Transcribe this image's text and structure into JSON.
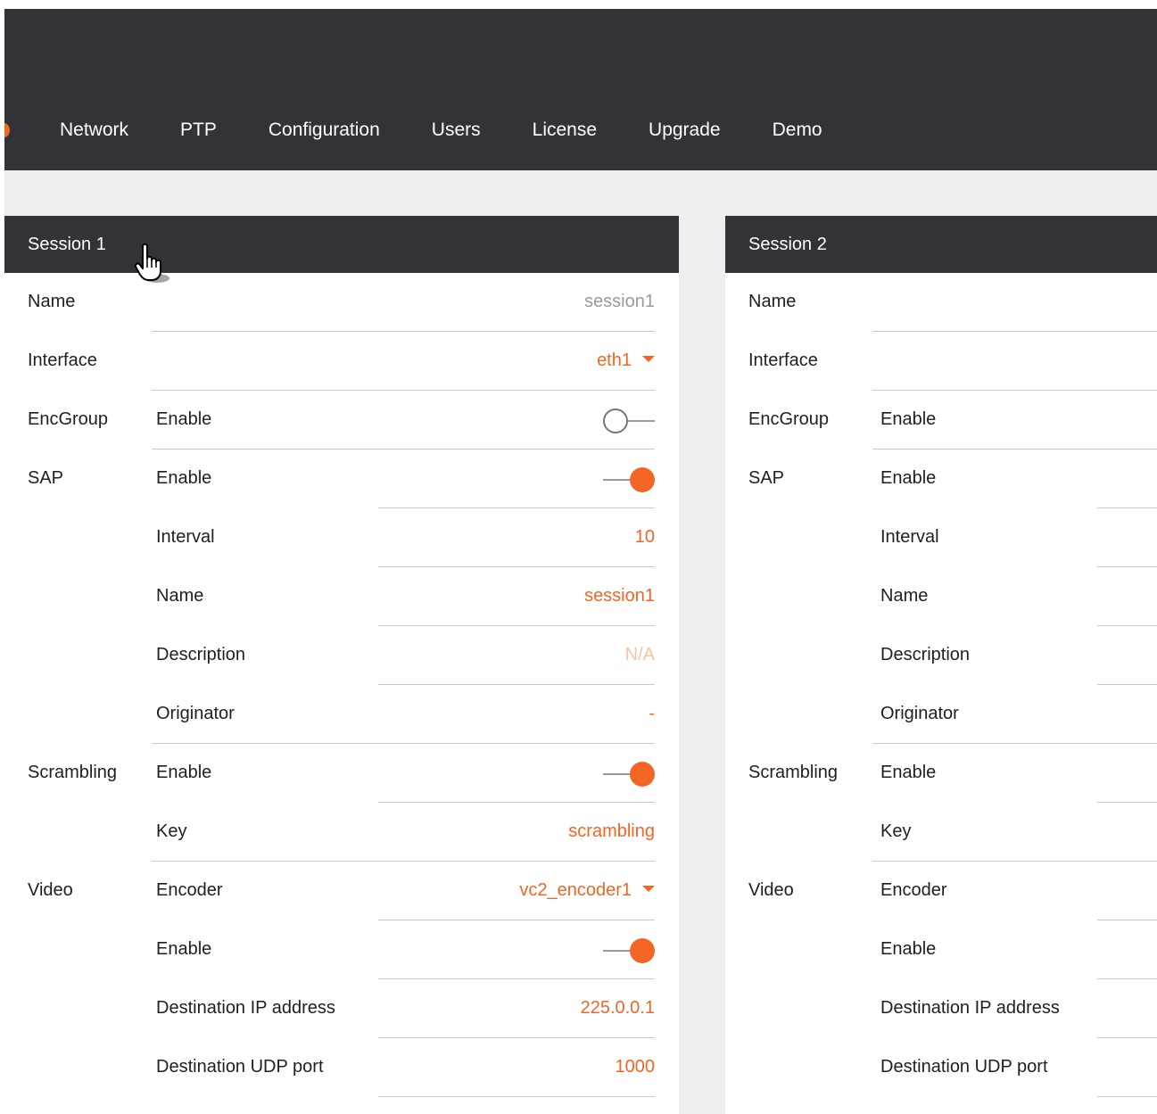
{
  "nav": {
    "items": [
      "Network",
      "PTP",
      "Configuration",
      "Users",
      "License",
      "Upgrade",
      "Demo"
    ]
  },
  "colors": {
    "accent": "#f26522",
    "topbar": "#323337",
    "background": "#eeeef0"
  },
  "sessions": [
    {
      "title": "Session 1",
      "rows": [
        {
          "group": "Name",
          "label": "",
          "type": "text",
          "value": "session1",
          "style": "muted"
        },
        {
          "group": "Interface",
          "label": "",
          "type": "select",
          "value": "eth1"
        },
        {
          "group": "EncGroup",
          "label": "Enable",
          "type": "toggle",
          "on": false
        },
        {
          "group": "SAP",
          "label": "Enable",
          "type": "toggle",
          "on": true
        },
        {
          "group": "",
          "label": "Interval",
          "type": "text",
          "value": "10"
        },
        {
          "group": "",
          "label": "Name",
          "type": "text",
          "value": "session1"
        },
        {
          "group": "",
          "label": "Description",
          "type": "text",
          "value": "N/A",
          "style": "faint"
        },
        {
          "group": "",
          "label": "Originator",
          "type": "text",
          "value": "-"
        },
        {
          "group": "Scrambling",
          "label": "Enable",
          "type": "toggle",
          "on": true
        },
        {
          "group": "",
          "label": "Key",
          "type": "text",
          "value": "scrambling"
        },
        {
          "group": "Video",
          "label": "Encoder",
          "type": "select",
          "value": "vc2_encoder1"
        },
        {
          "group": "",
          "label": "Enable",
          "type": "toggle",
          "on": true
        },
        {
          "group": "",
          "label": "Destination IP address",
          "type": "text",
          "value": "225.0.0.1"
        },
        {
          "group": "",
          "label": "Destination UDP port",
          "type": "text",
          "value": "1000"
        }
      ]
    },
    {
      "title": "Session 2",
      "rows": [
        {
          "group": "Name",
          "label": "",
          "type": "none"
        },
        {
          "group": "Interface",
          "label": "",
          "type": "none"
        },
        {
          "group": "EncGroup",
          "label": "Enable",
          "type": "none"
        },
        {
          "group": "SAP",
          "label": "Enable",
          "type": "none"
        },
        {
          "group": "",
          "label": "Interval",
          "type": "none"
        },
        {
          "group": "",
          "label": "Name",
          "type": "none"
        },
        {
          "group": "",
          "label": "Description",
          "type": "none"
        },
        {
          "group": "",
          "label": "Originator",
          "type": "none"
        },
        {
          "group": "Scrambling",
          "label": "Enable",
          "type": "none"
        },
        {
          "group": "",
          "label": "Key",
          "type": "none"
        },
        {
          "group": "Video",
          "label": "Encoder",
          "type": "none"
        },
        {
          "group": "",
          "label": "Enable",
          "type": "none"
        },
        {
          "group": "",
          "label": "Destination IP address",
          "type": "none"
        },
        {
          "group": "",
          "label": "Destination UDP port",
          "type": "none"
        }
      ]
    }
  ]
}
